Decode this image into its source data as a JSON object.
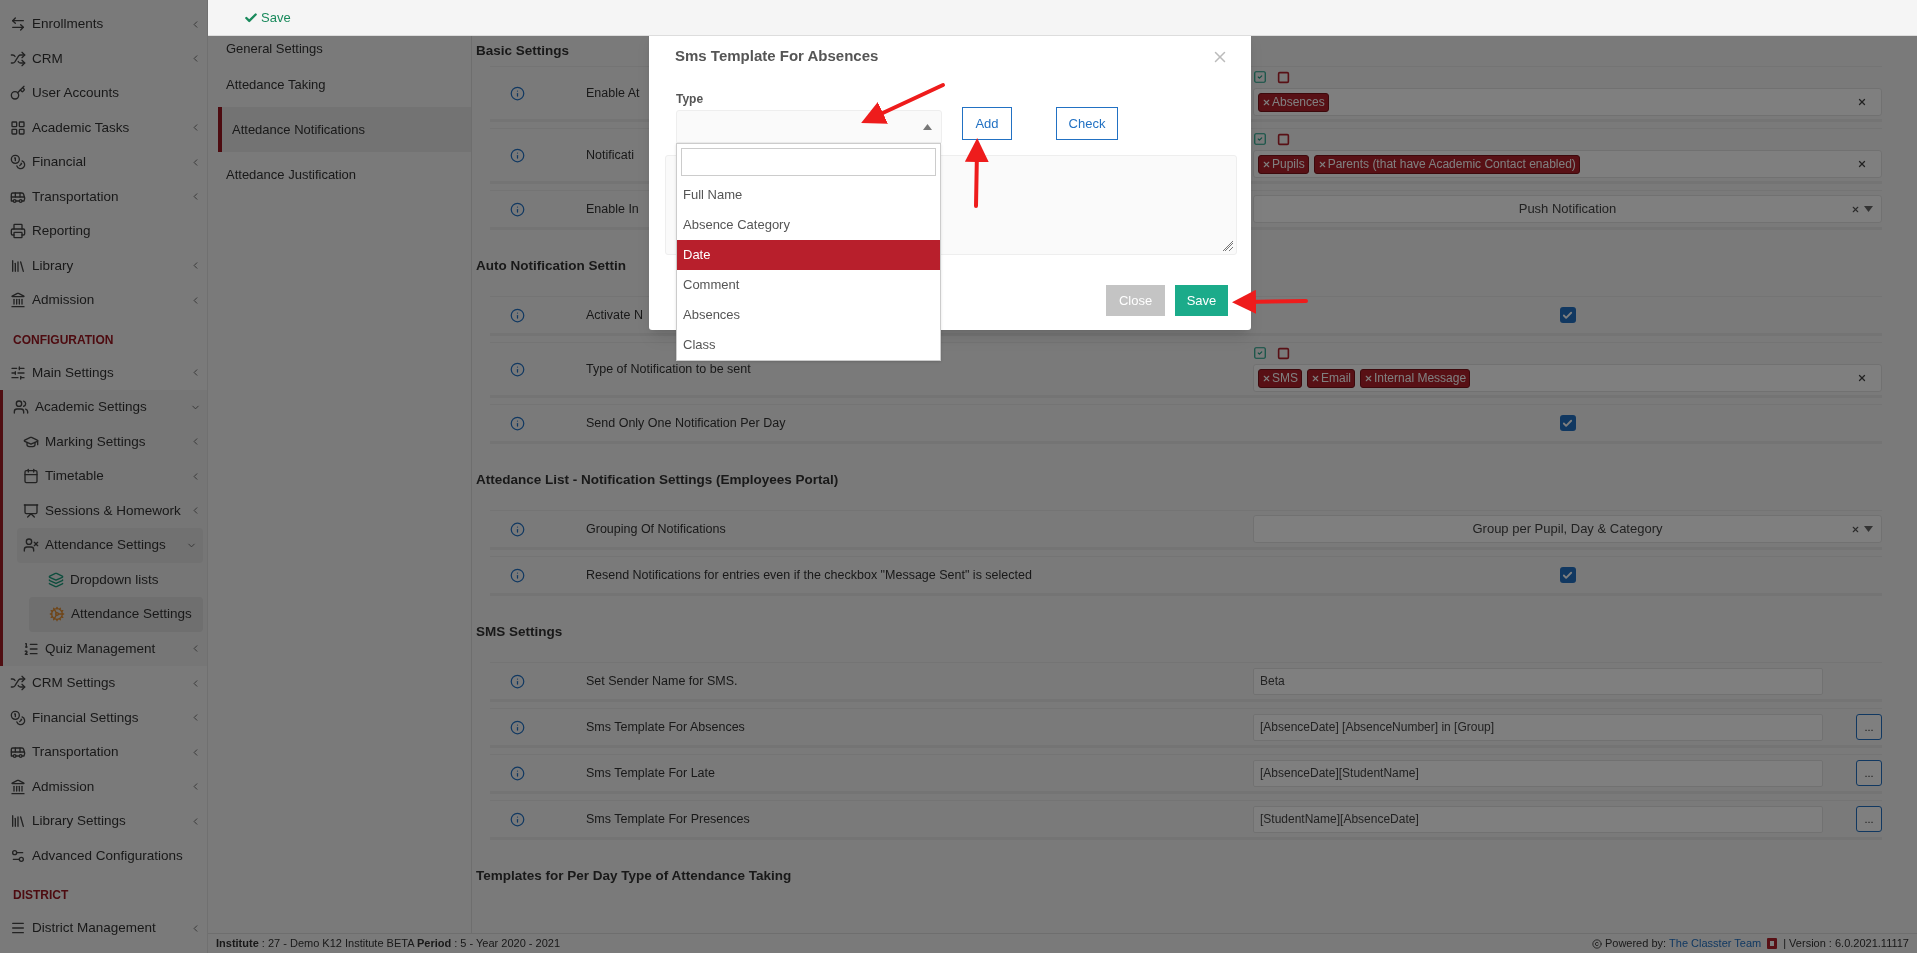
{
  "toolbar": {
    "save": "Save"
  },
  "sidebar": {
    "sections": [
      {
        "items": [
          {
            "label": "Enrollments",
            "submenu": true,
            "expanded": false,
            "selected": false
          },
          {
            "label": "CRM",
            "submenu": true,
            "expanded": false,
            "selected": false
          },
          {
            "label": "User Accounts",
            "submenu": false,
            "expanded": false,
            "selected": false
          },
          {
            "label": "Academic Tasks",
            "submenu": true,
            "expanded": false,
            "selected": false
          },
          {
            "label": "Financial",
            "submenu": true,
            "expanded": false,
            "selected": false
          },
          {
            "label": "Transportation",
            "submenu": true,
            "expanded": false,
            "selected": false
          },
          {
            "label": "Reporting",
            "submenu": false,
            "expanded": false,
            "selected": false
          },
          {
            "label": "Library",
            "submenu": true,
            "expanded": false,
            "selected": false
          },
          {
            "label": "Admission",
            "submenu": true,
            "expanded": false,
            "selected": false
          }
        ]
      },
      {
        "title": "CONFIGURATION",
        "items": [
          {
            "label": "Main Settings",
            "submenu": true,
            "expanded": false,
            "selected": false
          },
          {
            "label": "Academic Settings",
            "submenu": true,
            "expanded": true,
            "selected": false,
            "children": [
              {
                "label": "Marking Settings",
                "submenu": true,
                "expanded": false,
                "selected": false
              },
              {
                "label": "Timetable",
                "submenu": true,
                "expanded": false,
                "selected": false
              },
              {
                "label": "Sessions & Homework",
                "submenu": true,
                "expanded": false,
                "selected": false
              },
              {
                "label": "Attendance Settings",
                "submenu": true,
                "expanded": true,
                "selected": false,
                "children": [
                  {
                    "label": "Dropdown lists",
                    "submenu": false,
                    "expanded": false,
                    "selected": false
                  },
                  {
                    "label": "Attendance Settings",
                    "submenu": false,
                    "expanded": false,
                    "selected": true
                  }
                ]
              },
              {
                "label": "Quiz Management",
                "submenu": true,
                "expanded": false,
                "selected": false
              }
            ]
          },
          {
            "label": "CRM Settings",
            "submenu": true,
            "expanded": false,
            "selected": false
          },
          {
            "label": "Financial Settings",
            "submenu": true,
            "expanded": false,
            "selected": false
          },
          {
            "label": "Transportation",
            "submenu": true,
            "expanded": false,
            "selected": false
          },
          {
            "label": "Admission",
            "submenu": true,
            "expanded": false,
            "selected": false
          },
          {
            "label": "Library Settings",
            "submenu": true,
            "expanded": false,
            "selected": false
          },
          {
            "label": "Advanced Configurations",
            "submenu": false,
            "expanded": false,
            "selected": false
          }
        ]
      },
      {
        "title": "DISTRICT",
        "items": [
          {
            "label": "District Management",
            "submenu": true,
            "expanded": false,
            "selected": false
          }
        ]
      }
    ]
  },
  "subnav": [
    {
      "label": "General Settings",
      "selected": false
    },
    {
      "label": "Attedance Taking",
      "selected": false
    },
    {
      "label": "Attedance Notifications",
      "selected": true
    },
    {
      "label": "Attedance Justification",
      "selected": false
    }
  ],
  "sections": [
    {
      "title": "Basic Settings",
      "rows": [
        {
          "kind": "tags",
          "label": "Enable At",
          "tags": [
            "Absences"
          ]
        },
        {
          "kind": "tags",
          "label": "Notificati",
          "tags": [
            "Pupils",
            "Parents (that have Academic Contact enabled)"
          ]
        },
        {
          "kind": "select",
          "label": "Enable In",
          "value": "Push Notification"
        }
      ]
    },
    {
      "title": "Auto Notification Settin",
      "rows": [
        {
          "kind": "checkbox",
          "label": "Activate N",
          "checked": true
        },
        {
          "kind": "tags",
          "label": "Type of Notification to be sent",
          "tags": [
            "SMS",
            "Email",
            "Internal Message"
          ]
        },
        {
          "kind": "checkbox",
          "label": "Send Only One Notification Per Day",
          "checked": true
        }
      ]
    },
    {
      "title": "Attedance List - Notification Settings (Employees Portal)",
      "rows": [
        {
          "kind": "select",
          "label": "Grouping Of Notifications",
          "value": "Group per Pupil, Day & Category"
        },
        {
          "kind": "checkbox",
          "label": "Resend Notifications for entries even if the checkbox \"Message Sent\" is selected",
          "checked": true
        }
      ]
    },
    {
      "title": "SMS Settings",
      "rows": [
        {
          "kind": "text",
          "label": "Set Sender Name for SMS.",
          "value": "Beta"
        },
        {
          "kind": "text",
          "label": "Sms Template For Absences",
          "value": "[AbsenceDate] [AbsenceNumber] in [Group]",
          "button": "..."
        },
        {
          "kind": "text",
          "label": "Sms Template For Late",
          "value": "[AbsenceDate][StudentName]",
          "button": "..."
        },
        {
          "kind": "text",
          "label": "Sms Template For Presences",
          "value": "[StudentName][AbsenceDate]",
          "button": "..."
        }
      ]
    },
    {
      "title": "Templates for Per Day Type of Attendance Taking"
    }
  ],
  "footer": {
    "info": "**Institute** : 27 - Demo K12 Institute BETA **Period** : 5 - Year 2020 - 2021",
    "powered": "Powered by:",
    "link": "The Classter Team",
    "version": "| Version : 6.0.2021.11117"
  },
  "modal": {
    "title": "Sms Template For Absences",
    "type_label": "Type",
    "add": "Add",
    "check": "Check",
    "options": [
      {
        "label": "Full Name",
        "selected": false
      },
      {
        "label": "Absence Category",
        "selected": false
      },
      {
        "label": "Date",
        "selected": true
      },
      {
        "label": "Comment",
        "selected": false
      },
      {
        "label": "Absences",
        "selected": false
      },
      {
        "label": "Class",
        "selected": false
      }
    ],
    "close": "Close",
    "save": "Save"
  }
}
